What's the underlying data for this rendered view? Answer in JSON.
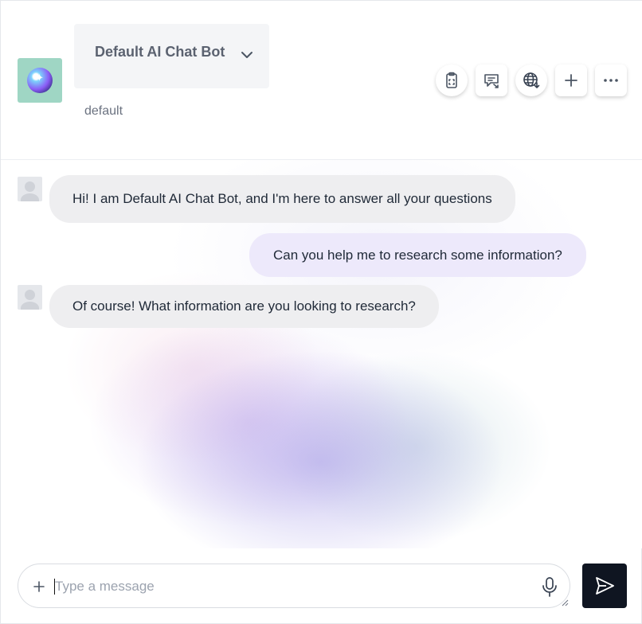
{
  "header": {
    "bot_name": "Default AI Chat Bot",
    "bot_subtitle": "default",
    "toolbar": [
      {
        "icon": "clipboard-scan-icon"
      },
      {
        "icon": "message-share-icon"
      },
      {
        "icon": "globe-download-icon"
      },
      {
        "icon": "plus-icon"
      },
      {
        "icon": "more-horizontal-icon"
      }
    ]
  },
  "messages": [
    {
      "role": "bot",
      "text": "Hi! I am Default AI Chat Bot, and I'm here to answer all your questions"
    },
    {
      "role": "user",
      "text": "Can you help me to research some information?"
    },
    {
      "role": "bot",
      "text": "Of course! What information are you looking to research?"
    }
  ],
  "composer": {
    "placeholder": "Type a message",
    "value": ""
  },
  "colors": {
    "accent": "#0f1521",
    "bot_bubble": "#eeeef0",
    "user_bubble": "#ede9fb",
    "avatar_bg": "#9fd6c4"
  }
}
